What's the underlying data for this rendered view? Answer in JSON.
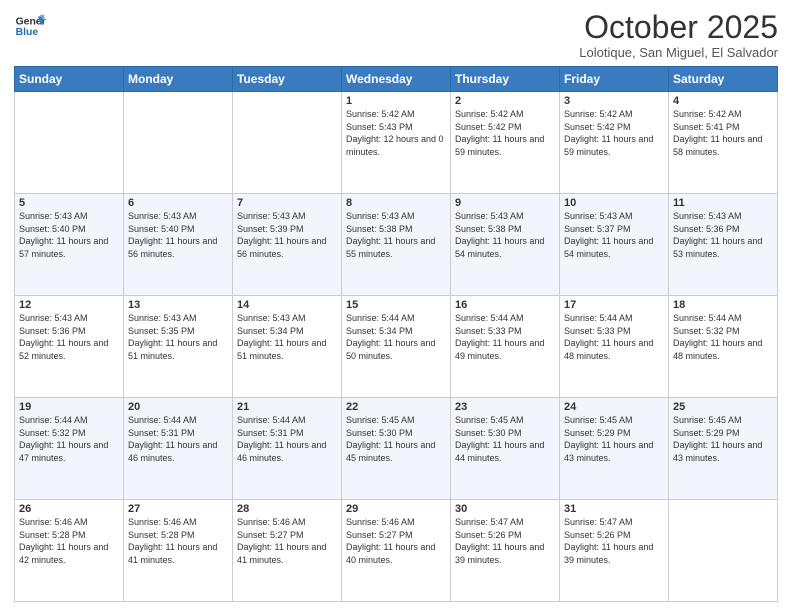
{
  "header": {
    "logo_line1": "General",
    "logo_line2": "Blue",
    "month": "October 2025",
    "location": "Lolotique, San Miguel, El Salvador"
  },
  "weekdays": [
    "Sunday",
    "Monday",
    "Tuesday",
    "Wednesday",
    "Thursday",
    "Friday",
    "Saturday"
  ],
  "weeks": [
    [
      {
        "day": "",
        "sunrise": "",
        "sunset": "",
        "daylight": ""
      },
      {
        "day": "",
        "sunrise": "",
        "sunset": "",
        "daylight": ""
      },
      {
        "day": "",
        "sunrise": "",
        "sunset": "",
        "daylight": ""
      },
      {
        "day": "1",
        "sunrise": "Sunrise: 5:42 AM",
        "sunset": "Sunset: 5:43 PM",
        "daylight": "Daylight: 12 hours and 0 minutes."
      },
      {
        "day": "2",
        "sunrise": "Sunrise: 5:42 AM",
        "sunset": "Sunset: 5:42 PM",
        "daylight": "Daylight: 11 hours and 59 minutes."
      },
      {
        "day": "3",
        "sunrise": "Sunrise: 5:42 AM",
        "sunset": "Sunset: 5:42 PM",
        "daylight": "Daylight: 11 hours and 59 minutes."
      },
      {
        "day": "4",
        "sunrise": "Sunrise: 5:42 AM",
        "sunset": "Sunset: 5:41 PM",
        "daylight": "Daylight: 11 hours and 58 minutes."
      }
    ],
    [
      {
        "day": "5",
        "sunrise": "Sunrise: 5:43 AM",
        "sunset": "Sunset: 5:40 PM",
        "daylight": "Daylight: 11 hours and 57 minutes."
      },
      {
        "day": "6",
        "sunrise": "Sunrise: 5:43 AM",
        "sunset": "Sunset: 5:40 PM",
        "daylight": "Daylight: 11 hours and 56 minutes."
      },
      {
        "day": "7",
        "sunrise": "Sunrise: 5:43 AM",
        "sunset": "Sunset: 5:39 PM",
        "daylight": "Daylight: 11 hours and 56 minutes."
      },
      {
        "day": "8",
        "sunrise": "Sunrise: 5:43 AM",
        "sunset": "Sunset: 5:38 PM",
        "daylight": "Daylight: 11 hours and 55 minutes."
      },
      {
        "day": "9",
        "sunrise": "Sunrise: 5:43 AM",
        "sunset": "Sunset: 5:38 PM",
        "daylight": "Daylight: 11 hours and 54 minutes."
      },
      {
        "day": "10",
        "sunrise": "Sunrise: 5:43 AM",
        "sunset": "Sunset: 5:37 PM",
        "daylight": "Daylight: 11 hours and 54 minutes."
      },
      {
        "day": "11",
        "sunrise": "Sunrise: 5:43 AM",
        "sunset": "Sunset: 5:36 PM",
        "daylight": "Daylight: 11 hours and 53 minutes."
      }
    ],
    [
      {
        "day": "12",
        "sunrise": "Sunrise: 5:43 AM",
        "sunset": "Sunset: 5:36 PM",
        "daylight": "Daylight: 11 hours and 52 minutes."
      },
      {
        "day": "13",
        "sunrise": "Sunrise: 5:43 AM",
        "sunset": "Sunset: 5:35 PM",
        "daylight": "Daylight: 11 hours and 51 minutes."
      },
      {
        "day": "14",
        "sunrise": "Sunrise: 5:43 AM",
        "sunset": "Sunset: 5:34 PM",
        "daylight": "Daylight: 11 hours and 51 minutes."
      },
      {
        "day": "15",
        "sunrise": "Sunrise: 5:44 AM",
        "sunset": "Sunset: 5:34 PM",
        "daylight": "Daylight: 11 hours and 50 minutes."
      },
      {
        "day": "16",
        "sunrise": "Sunrise: 5:44 AM",
        "sunset": "Sunset: 5:33 PM",
        "daylight": "Daylight: 11 hours and 49 minutes."
      },
      {
        "day": "17",
        "sunrise": "Sunrise: 5:44 AM",
        "sunset": "Sunset: 5:33 PM",
        "daylight": "Daylight: 11 hours and 48 minutes."
      },
      {
        "day": "18",
        "sunrise": "Sunrise: 5:44 AM",
        "sunset": "Sunset: 5:32 PM",
        "daylight": "Daylight: 11 hours and 48 minutes."
      }
    ],
    [
      {
        "day": "19",
        "sunrise": "Sunrise: 5:44 AM",
        "sunset": "Sunset: 5:32 PM",
        "daylight": "Daylight: 11 hours and 47 minutes."
      },
      {
        "day": "20",
        "sunrise": "Sunrise: 5:44 AM",
        "sunset": "Sunset: 5:31 PM",
        "daylight": "Daylight: 11 hours and 46 minutes."
      },
      {
        "day": "21",
        "sunrise": "Sunrise: 5:44 AM",
        "sunset": "Sunset: 5:31 PM",
        "daylight": "Daylight: 11 hours and 46 minutes."
      },
      {
        "day": "22",
        "sunrise": "Sunrise: 5:45 AM",
        "sunset": "Sunset: 5:30 PM",
        "daylight": "Daylight: 11 hours and 45 minutes."
      },
      {
        "day": "23",
        "sunrise": "Sunrise: 5:45 AM",
        "sunset": "Sunset: 5:30 PM",
        "daylight": "Daylight: 11 hours and 44 minutes."
      },
      {
        "day": "24",
        "sunrise": "Sunrise: 5:45 AM",
        "sunset": "Sunset: 5:29 PM",
        "daylight": "Daylight: 11 hours and 43 minutes."
      },
      {
        "day": "25",
        "sunrise": "Sunrise: 5:45 AM",
        "sunset": "Sunset: 5:29 PM",
        "daylight": "Daylight: 11 hours and 43 minutes."
      }
    ],
    [
      {
        "day": "26",
        "sunrise": "Sunrise: 5:46 AM",
        "sunset": "Sunset: 5:28 PM",
        "daylight": "Daylight: 11 hours and 42 minutes."
      },
      {
        "day": "27",
        "sunrise": "Sunrise: 5:46 AM",
        "sunset": "Sunset: 5:28 PM",
        "daylight": "Daylight: 11 hours and 41 minutes."
      },
      {
        "day": "28",
        "sunrise": "Sunrise: 5:46 AM",
        "sunset": "Sunset: 5:27 PM",
        "daylight": "Daylight: 11 hours and 41 minutes."
      },
      {
        "day": "29",
        "sunrise": "Sunrise: 5:46 AM",
        "sunset": "Sunset: 5:27 PM",
        "daylight": "Daylight: 11 hours and 40 minutes."
      },
      {
        "day": "30",
        "sunrise": "Sunrise: 5:47 AM",
        "sunset": "Sunset: 5:26 PM",
        "daylight": "Daylight: 11 hours and 39 minutes."
      },
      {
        "day": "31",
        "sunrise": "Sunrise: 5:47 AM",
        "sunset": "Sunset: 5:26 PM",
        "daylight": "Daylight: 11 hours and 39 minutes."
      },
      {
        "day": "",
        "sunrise": "",
        "sunset": "",
        "daylight": ""
      }
    ]
  ]
}
